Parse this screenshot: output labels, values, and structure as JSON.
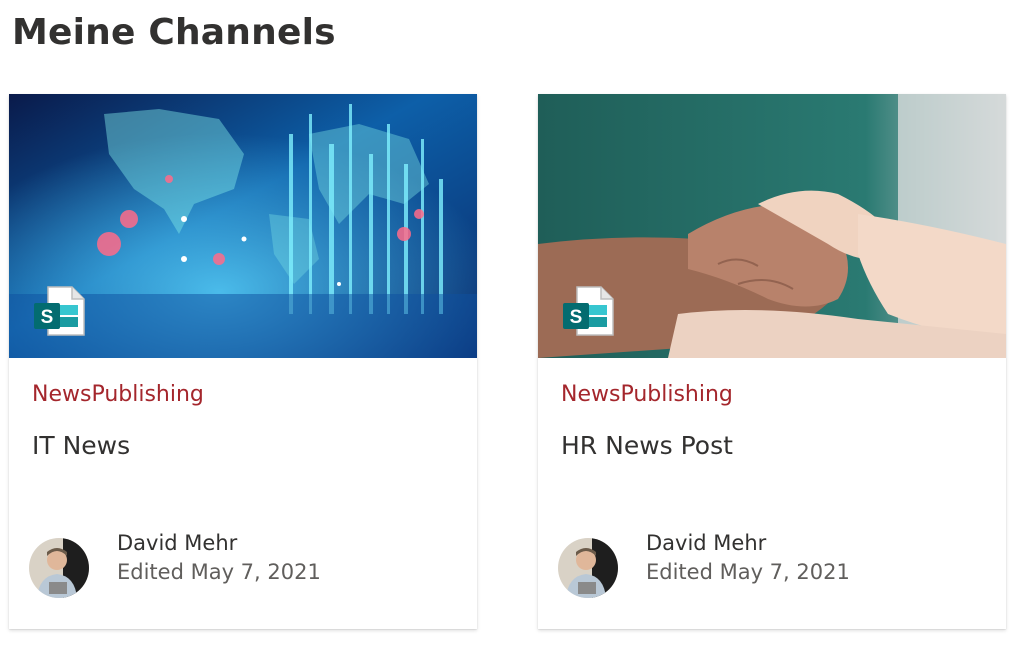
{
  "page": {
    "title": "Meine Channels"
  },
  "cards": [
    {
      "channel": "NewsPublishing",
      "title": "IT News",
      "author": "David Mehr",
      "edited": "Edited May 7, 2021",
      "thumbnail": "digital world map technology image",
      "icon": "sharepoint-page-icon"
    },
    {
      "channel": "NewsPublishing",
      "title": "HR News Post",
      "author": "David Mehr",
      "edited": "Edited May 7, 2021",
      "thumbnail": "holding hands image",
      "icon": "sharepoint-page-icon"
    }
  ],
  "colors": {
    "channel": "#a4262c",
    "text": "#323130",
    "secondary": "#605e5c",
    "sharepoint": "#036c70"
  }
}
